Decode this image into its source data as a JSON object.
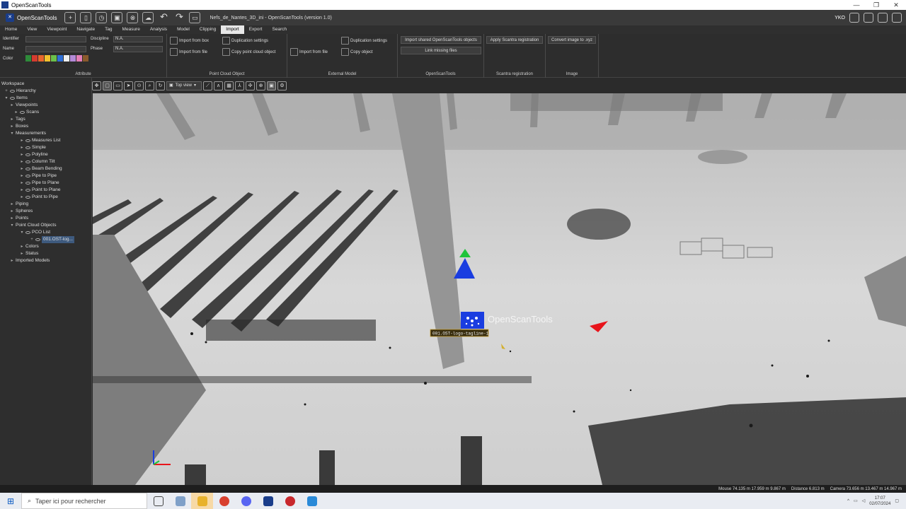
{
  "window": {
    "title": "OpenScanTools",
    "controls": [
      "—",
      "❐",
      "✕"
    ]
  },
  "toolbar": {
    "app_name": "OpenScanTools",
    "document": "Nefs_de_Nantes_3D_ini - OpenScanTools (version 1.0)",
    "user": "YKO",
    "icons": [
      "new-project-icon",
      "open-project-icon",
      "recent-icon",
      "save-icon",
      "close-icon",
      "cloud-icon",
      "undo-icon",
      "redo-icon",
      "image-icon"
    ]
  },
  "menu": {
    "items": [
      "Home",
      "View",
      "Viewpoint",
      "Navigate",
      "Tag",
      "Measure",
      "Analysis",
      "Model",
      "Clipping",
      "Import",
      "Export",
      "Search"
    ],
    "active": "Import"
  },
  "ribbon": {
    "attribute": {
      "title": "Attribute",
      "identifier_label": "Identifier",
      "name_label": "Name",
      "color_label": "Color",
      "discipline_label": "Discipline",
      "discipline_value": "N.A.",
      "phase_label": "Phase",
      "phase_value": "N.A.",
      "swatches": [
        "#2e8b3a",
        "#d43b2f",
        "#e8662c",
        "#f2c12e",
        "#6cc04a",
        "#2f6fd6",
        "#f0f0f0",
        "#b48ad8",
        "#e57fb8",
        "#8a5a2c"
      ]
    },
    "point_cloud_object": {
      "title": "Point Cloud Object",
      "import_box": "Import from box",
      "import_file": "Import from file",
      "duplication": "Duplication settings",
      "copy": "Copy point cloud object"
    },
    "external_model": {
      "title": "External Model",
      "import_file": "Import from file",
      "duplication": "Duplication settings",
      "copy": "Copy object"
    },
    "openscantools": {
      "title": "OpenScanTools",
      "import_shared": "Import shared OpenScanTools objects",
      "link_missing": "Link missing files"
    },
    "scantra": {
      "title": "Scantra registration",
      "apply": "Apply Scantra registration"
    },
    "image": {
      "title": "Image",
      "convert": "Convert image to .xyz"
    }
  },
  "tree": {
    "workspace": "Workspace",
    "hierarchy": "Hierarchy",
    "items": "Items",
    "viewpoints": "Viewpoints",
    "scans": "Scans",
    "tags": "Tags",
    "boxes": "Boxes",
    "measurements": "Measurements",
    "measures_list": "Measures List",
    "simple": "Simple",
    "polyline": "Polyline",
    "column_tilt": "Column Tilt",
    "beam_bending": "Beam Bending",
    "pipe_to_pipe": "Pipe to Pipe",
    "pipe_to_plane": "Pipe to Plane",
    "point_to_plane": "Point to Plane",
    "point_to_pipe": "Point to Pipe",
    "piping": "Piping",
    "spheres": "Spheres",
    "points": "Points",
    "point_cloud_objects": "Point Cloud Objects",
    "pco_list": "PCO List",
    "pco_item": "001.OST-log...",
    "colors": "Colors",
    "status": "Status",
    "imported_models": "Imported Models"
  },
  "viewtools": {
    "view_select": "Top view"
  },
  "viewport": {
    "object_label": "001.OST-logo-tagline-1",
    "logo_text": "OpenScanTools",
    "gizmo_colors": {
      "x": "#e8141b",
      "y": "#1fc43a",
      "z": "#1a3de0"
    }
  },
  "status": {
    "mouse": "Mouse 74.135 m 17.959 m 9.867 m",
    "distance": "Distance 6.813 m",
    "camera": "Camera 73.656 m 13.467 m 14.967 m"
  },
  "taskbar": {
    "search_placeholder": "Taper ici pour rechercher",
    "time": "17:07",
    "date": "02/07/2024"
  }
}
